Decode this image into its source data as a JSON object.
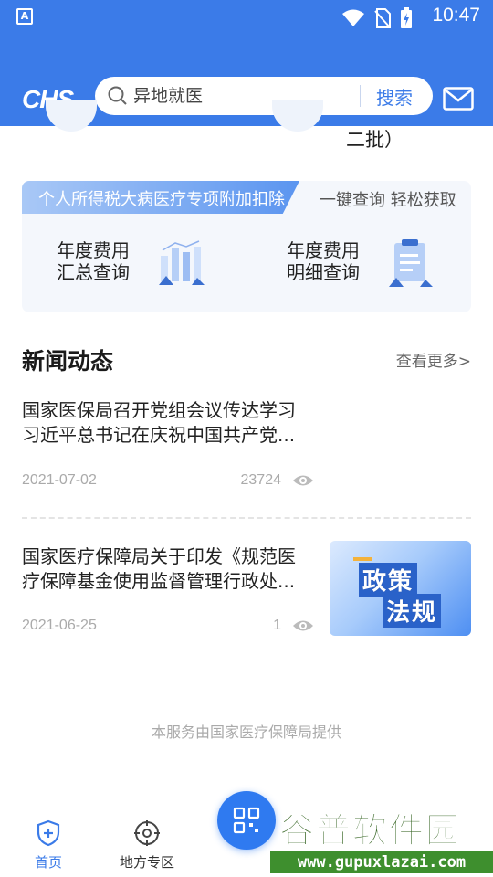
{
  "status_bar": {
    "time": "10:47",
    "left_icon": "A"
  },
  "header": {
    "logo": "CHS",
    "search": {
      "query": "异地就医",
      "button": "搜索"
    }
  },
  "partial_above": {
    "text": "二批）"
  },
  "tax_card": {
    "ribbon": "个人所得税大病医疗专项附加扣除",
    "slogan": "一键查询 轻松获取",
    "items": [
      {
        "line1": "年度费用",
        "line2": "汇总查询",
        "icon": "bar-chart-icon"
      },
      {
        "line1": "年度费用",
        "line2": "明细查询",
        "icon": "clipboard-icon"
      }
    ]
  },
  "news": {
    "title": "新闻动态",
    "more": "查看更多>",
    "items": [
      {
        "headline": "国家医保局召开党组会议传达学习习近平总书记在庆祝中国共产党...",
        "date": "2021-07-02",
        "views": "23724"
      },
      {
        "headline": "国家医疗保障局关于印发《规范医疗保障基金使用监督管理行政处...",
        "date": "2021-06-25",
        "views": "1",
        "image_line1": "政策",
        "image_line2": "法规"
      }
    ]
  },
  "footer_note": "本服务由国家医疗保障局提供",
  "bottom_nav": {
    "items": [
      {
        "label": "首页",
        "icon": "shield-plus-icon",
        "active": true
      },
      {
        "label": "地方专区",
        "icon": "location-target-icon",
        "active": false
      }
    ],
    "center": "qr-scan-icon"
  },
  "watermark": {
    "title": "谷普软件园",
    "url": "www.gupuxlazai.com"
  },
  "colors": {
    "primary": "#3b7be8",
    "card_bg": "#f4f7fc"
  }
}
